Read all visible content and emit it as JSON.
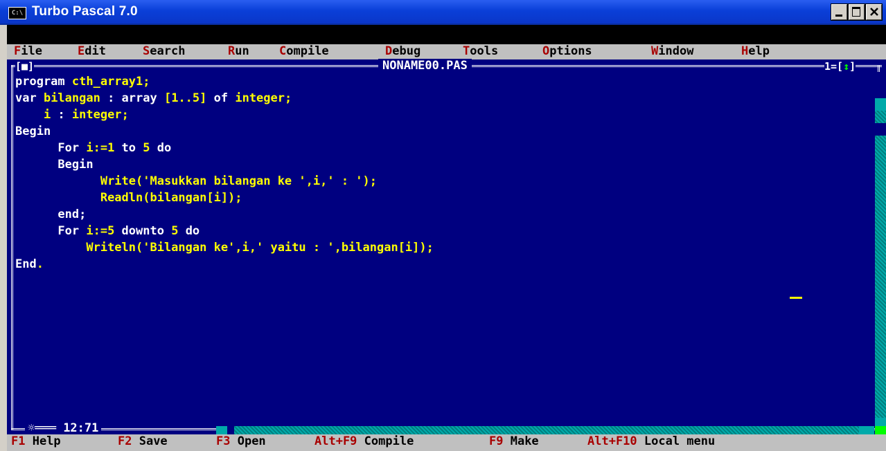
{
  "window": {
    "title": "Turbo Pascal 7.0",
    "icon_text": "C:\\",
    "controls": [
      "minimize",
      "maximize",
      "close"
    ]
  },
  "menubar": {
    "items": [
      {
        "hotkey": "F",
        "rest": "ile"
      },
      {
        "hotkey": "E",
        "rest": "dit"
      },
      {
        "hotkey": "S",
        "rest": "earch"
      },
      {
        "hotkey": "R",
        "rest": "un"
      },
      {
        "hotkey": "C",
        "rest": "ompile"
      },
      {
        "hotkey": "D",
        "rest": "ebug"
      },
      {
        "hotkey": "T",
        "rest": "ools"
      },
      {
        "hotkey": "O",
        "rest": "ptions"
      },
      {
        "hotkey": "W",
        "rest": "indow"
      },
      {
        "hotkey": "H",
        "rest": "elp"
      }
    ]
  },
  "editor": {
    "close_box": "[■]",
    "filename": "NONAME00.PAS",
    "window_number": "1=[",
    "window_number_arrow": "↕",
    "window_number_end": "]",
    "cursor_position": "12:71",
    "lines": [
      [
        {
          "t": "program ",
          "c": "kw"
        },
        {
          "t": "cth_array1;",
          "c": "id"
        }
      ],
      [
        {
          "t": "var ",
          "c": "kw"
        },
        {
          "t": "bilangan",
          "c": "id"
        },
        {
          "t": " : array ",
          "c": "kw"
        },
        {
          "t": "[1..5]",
          "c": "id"
        },
        {
          "t": " of ",
          "c": "kw"
        },
        {
          "t": "integer;",
          "c": "id"
        }
      ],
      [
        {
          "t": "    ",
          "c": "kw"
        },
        {
          "t": "i",
          "c": "id"
        },
        {
          "t": " : ",
          "c": "kw"
        },
        {
          "t": "integer;",
          "c": "id"
        }
      ],
      [
        {
          "t": "Begin",
          "c": "kw"
        }
      ],
      [
        {
          "t": "      For ",
          "c": "kw"
        },
        {
          "t": "i:=1",
          "c": "id"
        },
        {
          "t": " to ",
          "c": "kw"
        },
        {
          "t": "5",
          "c": "id"
        },
        {
          "t": " do",
          "c": "kw"
        }
      ],
      [
        {
          "t": "      Begin",
          "c": "kw"
        }
      ],
      [
        {
          "t": "            ",
          "c": "kw"
        },
        {
          "t": "Write('Masukkan bilangan ke ',i,' : ');",
          "c": "id"
        }
      ],
      [
        {
          "t": "            ",
          "c": "kw"
        },
        {
          "t": "Readln(bilangan[i]);",
          "c": "id"
        }
      ],
      [
        {
          "t": "      end;",
          "c": "kw"
        }
      ],
      [
        {
          "t": "      For ",
          "c": "kw"
        },
        {
          "t": "i:=5",
          "c": "id"
        },
        {
          "t": " downto ",
          "c": "kw"
        },
        {
          "t": "5",
          "c": "id"
        },
        {
          "t": " do",
          "c": "kw"
        }
      ],
      [
        {
          "t": "          ",
          "c": "kw"
        },
        {
          "t": "Writeln('Bilangan ke',i,' yaitu : ',bilangan[i]);",
          "c": "id"
        }
      ],
      [
        {
          "t": "End",
          "c": "kw"
        },
        {
          "t": ".",
          "c": "id"
        }
      ]
    ]
  },
  "statusbar": {
    "items": [
      {
        "key": "F1",
        "label": " Help"
      },
      {
        "key": "F2",
        "label": " Save"
      },
      {
        "key": "F3",
        "label": " Open"
      },
      {
        "key": "Alt+F9",
        "label": " Compile"
      },
      {
        "key": "F9",
        "label": " Make"
      },
      {
        "key": "Alt+F10",
        "label": " Local menu"
      }
    ]
  },
  "colors": {
    "background": "#000080",
    "keyword": "#ffffff",
    "identifier": "#ffff00",
    "menu_hotkey": "#a80000",
    "menu_bg": "#c0c0c0"
  }
}
